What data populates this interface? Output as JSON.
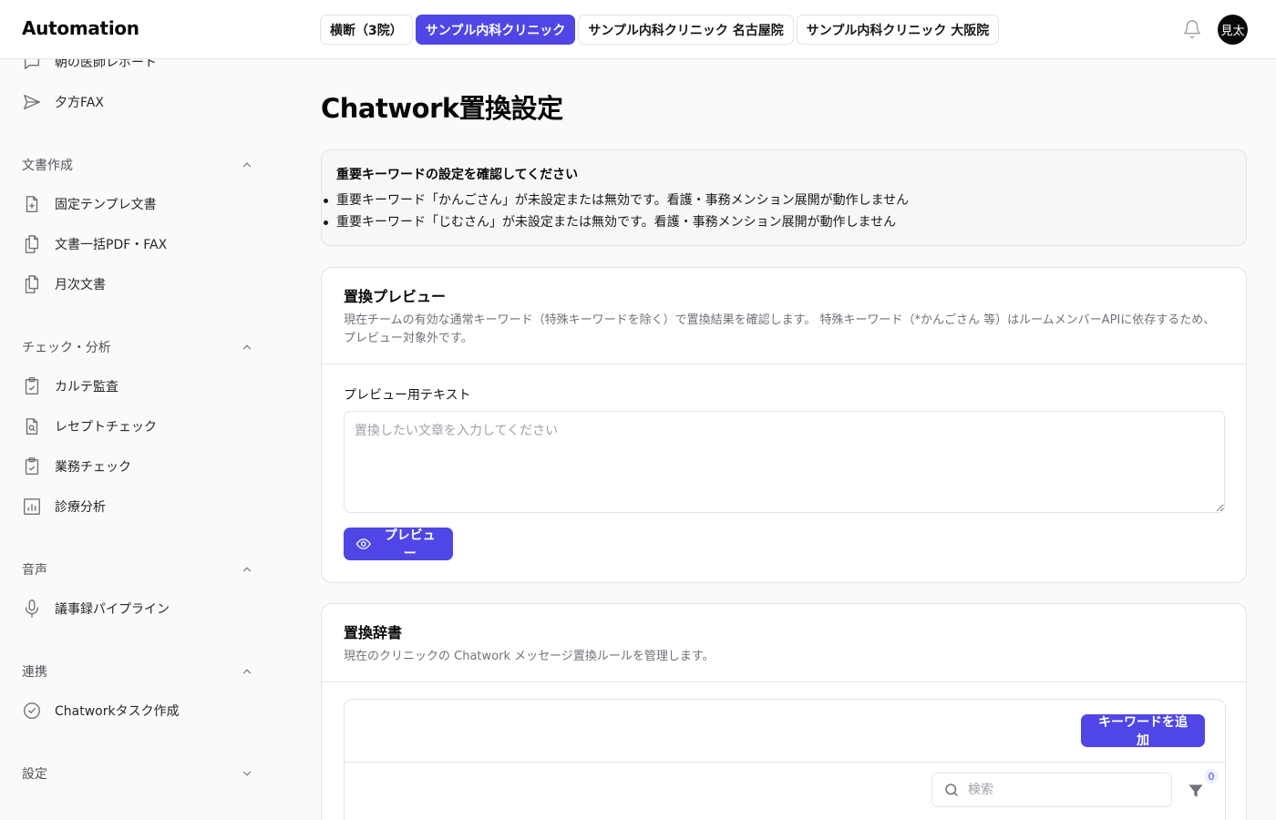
{
  "app": {
    "title": "Automation"
  },
  "tabs": [
    {
      "label": "横断（3院）",
      "active": false
    },
    {
      "label": "サンプル内科クリニック",
      "active": true
    },
    {
      "label": "サンプル内科クリニック 名古屋院",
      "active": false
    },
    {
      "label": "サンプル内科クリニック 大阪院",
      "active": false
    }
  ],
  "header": {
    "avatar_text": "見太",
    "bell_icon": "bell-icon"
  },
  "sidebar": {
    "items_top": [
      {
        "label": "朝の医師レポート",
        "icon": "message-square-icon"
      },
      {
        "label": "夕方FAX",
        "icon": "send-icon"
      }
    ],
    "groups": [
      {
        "label": "文書作成",
        "expanded": true,
        "items": [
          {
            "label": "固定テンプレ文書",
            "icon": "file-plus-icon"
          },
          {
            "label": "文書一括PDF・FAX",
            "icon": "files-icon"
          },
          {
            "label": "月次文書",
            "icon": "files-icon"
          }
        ]
      },
      {
        "label": "チェック・分析",
        "expanded": true,
        "items": [
          {
            "label": "カルテ監査",
            "icon": "clipboard-check-icon"
          },
          {
            "label": "レセプトチェック",
            "icon": "file-search-icon"
          },
          {
            "label": "業務チェック",
            "icon": "clipboard-check-icon"
          },
          {
            "label": "診療分析",
            "icon": "bar-chart-icon"
          }
        ]
      },
      {
        "label": "音声",
        "expanded": true,
        "items": [
          {
            "label": "議事録パイプライン",
            "icon": "mic-icon"
          }
        ]
      },
      {
        "label": "連携",
        "expanded": true,
        "items": [
          {
            "label": "Chatworkタスク作成",
            "icon": "check-circle-icon"
          }
        ]
      },
      {
        "label": "設定",
        "expanded": false,
        "items": []
      }
    ]
  },
  "page": {
    "title": "Chatwork置換設定"
  },
  "alert": {
    "title": "重要キーワードの設定を確認してください",
    "items": [
      "重要キーワード「かんごさん」が未設定または無効です。看護・事務メンション展開が動作しません",
      "重要キーワード「じむさん」が未設定または無効です。看護・事務メンション展開が動作しません"
    ]
  },
  "preview_card": {
    "title": "置換プレビュー",
    "description": "現在チームの有効な通常キーワード（特殊キーワードを除く）で置換結果を確認します。 特殊キーワード（*かんごさん 等）はルームメンバーAPIに依存するため、プレビュー対象外です。",
    "field_label": "プレビュー用テキスト",
    "placeholder": "置換したい文章を入力してください",
    "button_label": "プレビュー"
  },
  "dictionary_card": {
    "title": "置換辞書",
    "description": "現在のクリニックの Chatwork メッセージ置換ルールを管理します。",
    "add_button_label": "キーワードを追加",
    "search_placeholder": "検索",
    "filter_count": "0"
  }
}
